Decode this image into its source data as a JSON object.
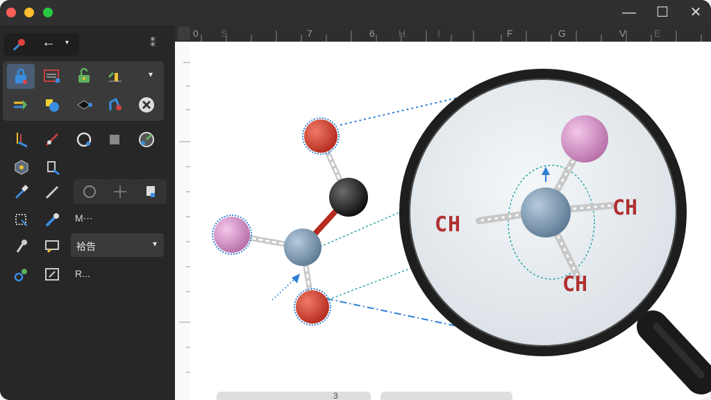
{
  "window": {
    "controls": {
      "minimize": "—",
      "maximize": "☐",
      "close": "✕"
    }
  },
  "toolbar": {
    "back_arrow": "←",
    "back_caret": "▾",
    "pin": "⁑",
    "panel_caret": "▾",
    "labels": {
      "m": "M⋯",
      "r": "R..."
    },
    "dropdown_value": "袷告",
    "dropdown_caret": "▾"
  },
  "ruler": {
    "top_labels": [
      "0",
      "S",
      "7",
      "6",
      "H",
      "I",
      "F",
      "G",
      "V",
      "E"
    ]
  },
  "molecule": {
    "magnifier_labels": [
      "CH",
      "CH",
      "CH"
    ]
  },
  "bottom_tabs": [
    "3"
  ],
  "colors": {
    "oxygen": "#d04030",
    "carbon_black": "#1e1e1e",
    "carbon_central": "#7f9bb3",
    "iodine": "#d990c9",
    "bond": "#d8d8d8",
    "label_red": "#b03030",
    "selection_blue": "#2f7fd6",
    "dotted_teal": "#2aa6a6"
  }
}
